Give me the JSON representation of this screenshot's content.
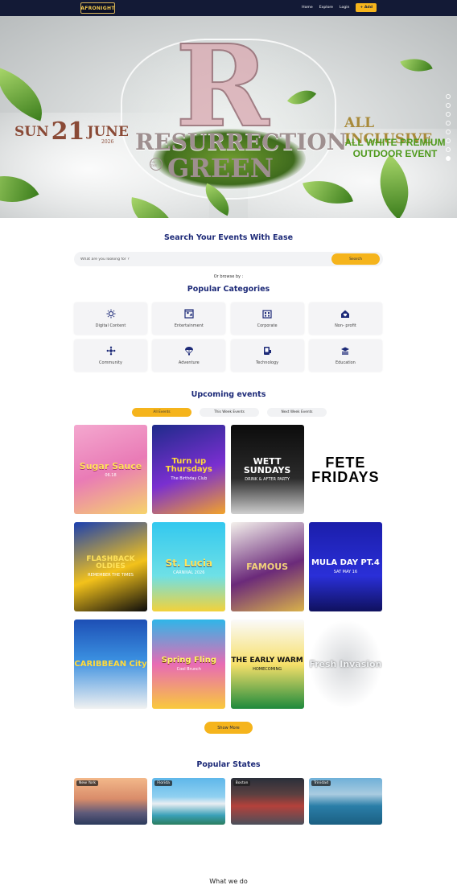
{
  "nav": {
    "logo": "AFRONIGHT",
    "links": [
      "Home",
      "Explore",
      "Login"
    ],
    "cta": "+ Add"
  },
  "hero": {
    "date_day": "SUN",
    "date_num": "21",
    "date_month": "JUNE",
    "date_year": "2026",
    "title_line1": "RESURRECTION",
    "title_on": "ON THE",
    "title_line2": "GREEN",
    "right_line1": "ALL INCLUSIVE",
    "right_line2": "ALL WHITE PREMIUM OUTDOOR EVENT",
    "slide_count": 8,
    "active_slide": 8
  },
  "search": {
    "heading": "Search Your Events With Ease",
    "placeholder": "What are you looking for ?",
    "button": "Search",
    "browse_text": "Or browse by :"
  },
  "categories": {
    "heading": "Popular Categories",
    "items": [
      {
        "label": "Digital Content",
        "icon": "sun-icon"
      },
      {
        "label": "Entertainment",
        "icon": "entertainment-icon"
      },
      {
        "label": "Corporate",
        "icon": "corporate-icon"
      },
      {
        "label": "Non- profit",
        "icon": "nonprofit-icon"
      },
      {
        "label": "Community",
        "icon": "community-icon"
      },
      {
        "label": "Adventure",
        "icon": "parachute-icon"
      },
      {
        "label": "Technology",
        "icon": "technology-icon"
      },
      {
        "label": "Education",
        "icon": "education-icon"
      }
    ]
  },
  "events": {
    "heading": "Upcoming events",
    "tabs": [
      "All Events",
      "This Week Events",
      "Next Week Events"
    ],
    "posters": [
      {
        "title": "Sugar Sauce",
        "sub": "06.18"
      },
      {
        "title": "Turn up Thursdays",
        "sub": "The Birthday Club"
      },
      {
        "title": "WETT SUNDAYS",
        "sub": "DRINK & AFTER PARTY"
      },
      {
        "title": "FETE FRIDAYS",
        "sub": ""
      },
      {
        "title": "FLASHBACK OLDIES",
        "sub": "REMEMBER THE TIMES"
      },
      {
        "title": "St. Lucia",
        "sub": "CARNIVAL 2026"
      },
      {
        "title": "FAMOUS",
        "sub": ""
      },
      {
        "title": "MULA DAY PT.4",
        "sub": "SAT MAY 16"
      },
      {
        "title": "CARIBBEAN City",
        "sub": ""
      },
      {
        "title": "Spring Fling",
        "sub": "Cool Brunch"
      },
      {
        "title": "THE EARLY WARM",
        "sub": "HOMECOMING"
      },
      {
        "title": "Fresh Invasion",
        "sub": ""
      }
    ],
    "show_more": "Show More"
  },
  "states": {
    "heading": "Popular States",
    "items": [
      "New York",
      "Florida",
      "Boston",
      "Trinidad"
    ]
  },
  "what_we_do": "What we do",
  "colors": {
    "nav_bg": "#131a36",
    "accent": "#f5b41c",
    "heading": "#1d2a78"
  }
}
